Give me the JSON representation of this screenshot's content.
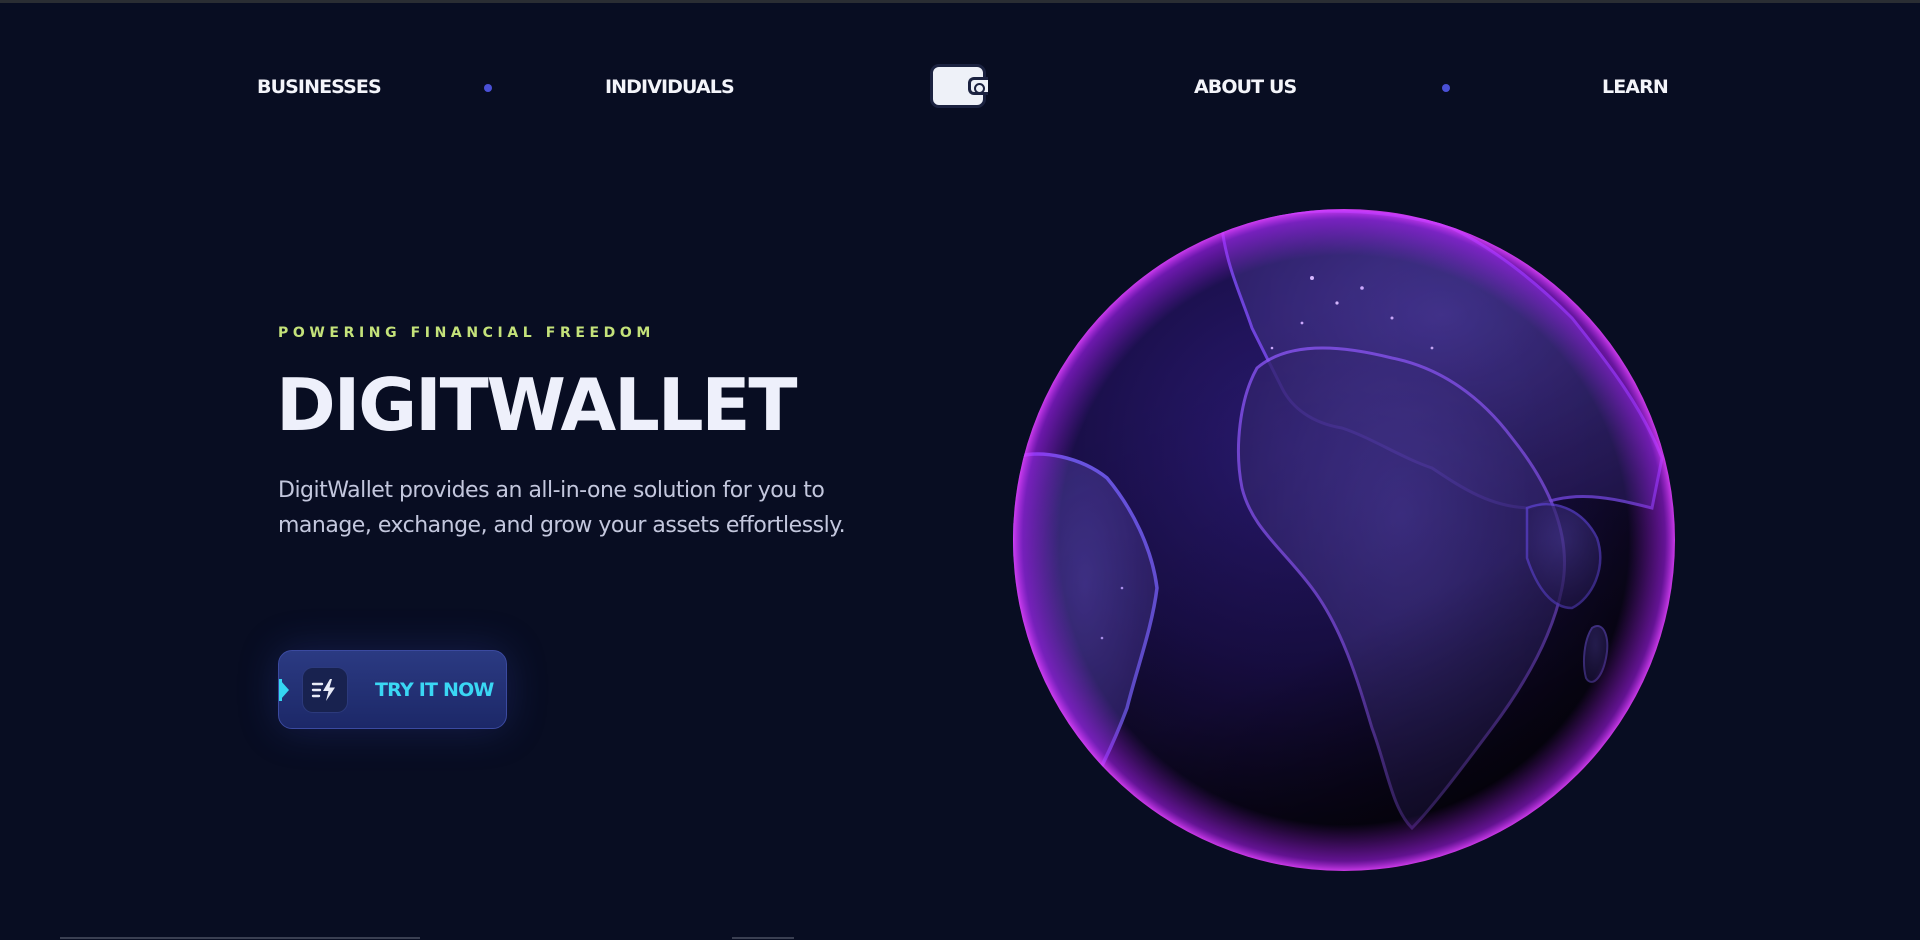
{
  "nav": {
    "items": [
      {
        "label": "BUSINESSES"
      },
      {
        "label": "INDIVIDUALS"
      },
      {
        "label": "ABOUT US"
      },
      {
        "label": "LEARN"
      }
    ],
    "logo_icon": "wallet-icon"
  },
  "hero": {
    "eyebrow": "POWERING FINANCIAL FREEDOM",
    "title": "DIGITWALLET",
    "description": "DigitWallet provides an all-in-one solution for you to manage, exchange, and grow your assets effortlessly.",
    "cta": {
      "label": "TRY IT NOW",
      "icon": "fast-bolt-icon"
    },
    "visual": "globe"
  },
  "colors": {
    "background": "#080d22",
    "eyebrow": "#c4e27a",
    "nav_dot": "#4a50d6",
    "cta_text": "#3ad7f4",
    "cta_bg": "#22307a",
    "globe_glow": "#a020f0"
  }
}
